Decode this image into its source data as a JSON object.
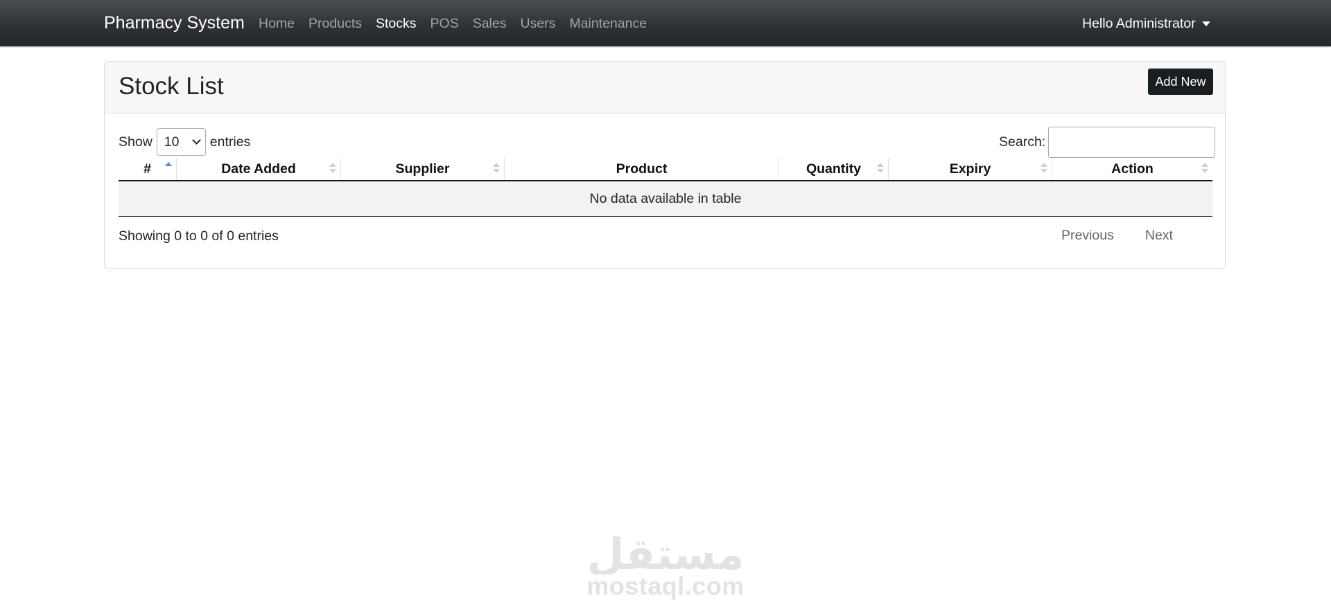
{
  "navbar": {
    "brand": "Pharmacy System",
    "links": [
      {
        "label": "Home",
        "active": false
      },
      {
        "label": "Products",
        "active": false
      },
      {
        "label": "Stocks",
        "active": true
      },
      {
        "label": "POS",
        "active": false
      },
      {
        "label": "Sales",
        "active": false
      },
      {
        "label": "Users",
        "active": false
      },
      {
        "label": "Maintenance",
        "active": false
      }
    ],
    "user_greeting": "Hello Administrator"
  },
  "card": {
    "title": "Stock List",
    "add_button": "Add New"
  },
  "table_controls": {
    "show_label": "Show",
    "length_value": "10",
    "entries_label": "entries",
    "search_label": "Search:",
    "search_value": ""
  },
  "table": {
    "columns": [
      {
        "label": "#",
        "sort": "asc"
      },
      {
        "label": "Date Added",
        "sort": "both"
      },
      {
        "label": "Supplier",
        "sort": "both"
      },
      {
        "label": "Product",
        "sort": "none"
      },
      {
        "label": "Quantity",
        "sort": "both"
      },
      {
        "label": "Expiry",
        "sort": "both"
      },
      {
        "label": "Action",
        "sort": "both"
      }
    ],
    "empty_message": "No data available in table"
  },
  "footer": {
    "info": "Showing 0 to 0 of 0 entries",
    "previous": "Previous",
    "next": "Next"
  },
  "watermark": {
    "text": "mostaql.com",
    "logo_text": "مستقل"
  },
  "colors": {
    "navbar": "#343a40",
    "add_button": "#1b1e21",
    "sort_active": "#5a8ec2",
    "empty_row": "#f2f2f2"
  }
}
